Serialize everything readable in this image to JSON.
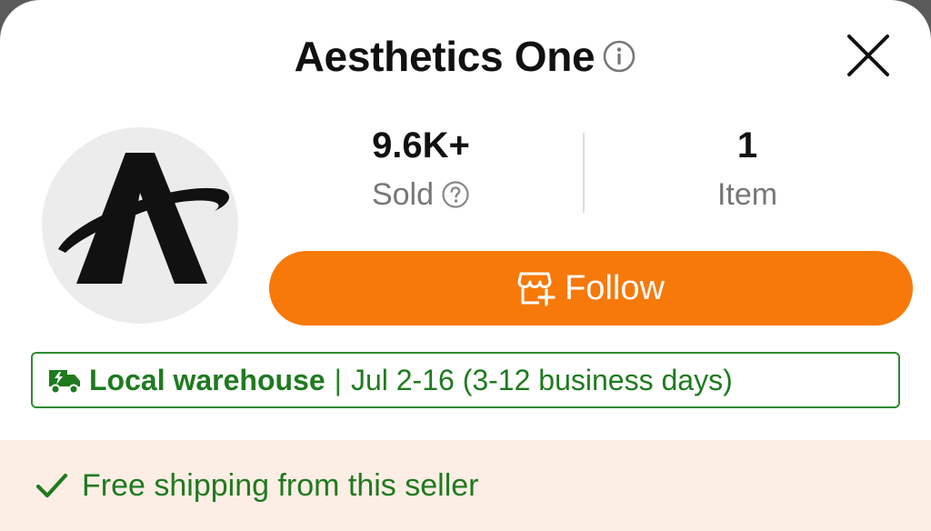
{
  "store": {
    "name": "Aesthetics One",
    "info_icon": "info-circle-icon",
    "close_icon": "close-icon",
    "logo_icon": "aesthetics-one-logo"
  },
  "stats": {
    "sold_value": "9.6K+",
    "sold_label": "Sold",
    "sold_help_icon": "question-circle-icon",
    "item_value": "1",
    "item_label": "Item"
  },
  "follow_button": {
    "label": "Follow",
    "icon": "store-add-icon",
    "color": "#F77909"
  },
  "delivery": {
    "icon": "fast-truck-icon",
    "warehouse": "Local warehouse",
    "separator": "|",
    "eta": "Jul 2-16 (3-12 business days)",
    "color": "#1F7A1F"
  },
  "shipping": {
    "icon": "check-icon",
    "text": "Free shipping from this seller",
    "background": "#FDEEE5"
  }
}
